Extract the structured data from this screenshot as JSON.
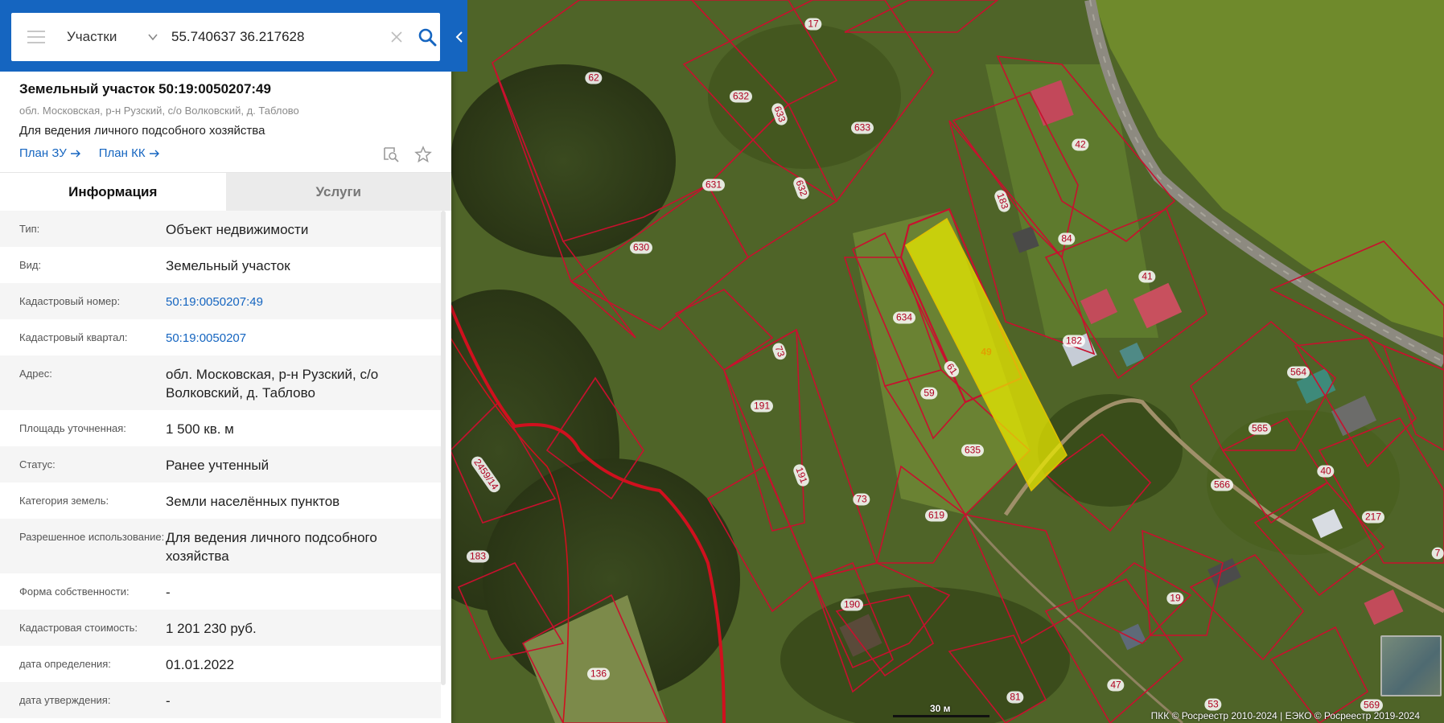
{
  "search": {
    "type_label": "Участки",
    "query": "55.740637 36.217628"
  },
  "object": {
    "title": "Земельный участок 50:19:0050207:49",
    "address": "обл. Московская, р-н Рузский, с/о Волковский, д. Таблово",
    "purpose": "Для ведения личного подсобного хозяйства",
    "plan_zu": "План ЗУ",
    "plan_kk": "План КК"
  },
  "tabs": [
    {
      "label": "Информация",
      "active": true
    },
    {
      "label": "Услуги",
      "active": false
    }
  ],
  "info": [
    {
      "label": "Тип:",
      "value": "Объект недвижимости"
    },
    {
      "label": "Вид:",
      "value": "Земельный участок"
    },
    {
      "label": "Кадастровый номер:",
      "value": "50:19:0050207:49",
      "link": true
    },
    {
      "label": "Кадастровый квартал:",
      "value": "50:19:0050207",
      "link": true
    },
    {
      "label": "Адрес:",
      "value": "обл. Московская, р-н Рузский, с/о Волковский, д. Таблово"
    },
    {
      "label": "Площадь уточненная:",
      "value": "1 500 кв. м"
    },
    {
      "label": "Статус:",
      "value": "Ранее учтенный"
    },
    {
      "label": "Категория земель:",
      "value": "Земли населённых пунктов"
    },
    {
      "label": "Разрешенное использование:",
      "value": "Для ведения личного подсобного хозяйства"
    },
    {
      "label": "Форма собственности:",
      "value": "-"
    },
    {
      "label": "Кадастровая стоимость:",
      "value": "1 201 230 руб."
    },
    {
      "label": "дата определения:",
      "value": "01.01.2022"
    },
    {
      "label": "дата утверждения:",
      "value": "-"
    }
  ],
  "map": {
    "plot_labels": [
      {
        "text": "17"
      },
      {
        "text": "62"
      },
      {
        "text": "632"
      },
      {
        "text": "633"
      },
      {
        "text": "633"
      },
      {
        "text": "631"
      },
      {
        "text": "632"
      },
      {
        "text": "630"
      },
      {
        "text": "42"
      },
      {
        "text": "183"
      },
      {
        "text": "84"
      },
      {
        "text": "41"
      },
      {
        "text": "634"
      },
      {
        "text": "49"
      },
      {
        "text": "182"
      },
      {
        "text": "73"
      },
      {
        "text": "61"
      },
      {
        "text": "59"
      },
      {
        "text": "564"
      },
      {
        "text": "191"
      },
      {
        "text": "565"
      },
      {
        "text": "635"
      },
      {
        "text": "191"
      },
      {
        "text": "40"
      },
      {
        "text": "566"
      },
      {
        "text": "73"
      },
      {
        "text": "619"
      },
      {
        "text": "217"
      },
      {
        "text": "2459/14"
      },
      {
        "text": "183"
      },
      {
        "text": "190"
      },
      {
        "text": "19"
      },
      {
        "text": "136"
      },
      {
        "text": "47"
      },
      {
        "text": "53"
      },
      {
        "text": "81"
      },
      {
        "text": "569"
      },
      {
        "text": "7"
      }
    ],
    "scale_label": "30 м",
    "attribution": "ПКК © Росреестр 2010-2024 | ЕЭКО © Росреестр 2019-2024",
    "colors": {
      "boundary": "#c8102e",
      "selected_fill": "#e8e800",
      "search_bar": "#1565c0",
      "link": "#1565c0"
    }
  }
}
